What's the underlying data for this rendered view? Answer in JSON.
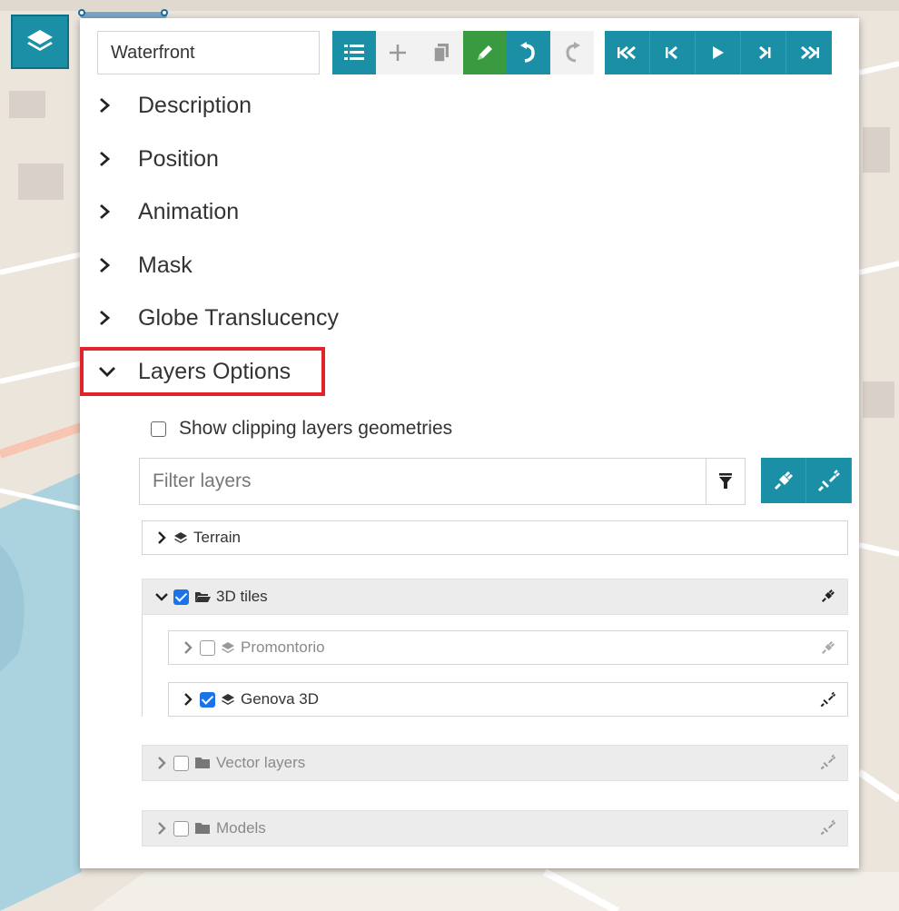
{
  "toolbar": {
    "story_name": "Waterfront"
  },
  "sections": [
    {
      "label": "Description",
      "expanded": false
    },
    {
      "label": "Position",
      "expanded": false
    },
    {
      "label": "Animation",
      "expanded": false
    },
    {
      "label": "Mask",
      "expanded": false
    },
    {
      "label": "Globe Translucency",
      "expanded": false
    },
    {
      "label": "Layers Options",
      "expanded": true
    }
  ],
  "layers_options": {
    "show_clipping_label": "Show clipping layers geometries",
    "show_clipping_checked": false,
    "filter_placeholder": "Filter layers",
    "tree": [
      {
        "label": "Terrain",
        "type": "layer",
        "checked": null,
        "expanded": false
      },
      {
        "label": "3D tiles",
        "type": "group",
        "checked": true,
        "expanded": true,
        "children": [
          {
            "label": "Promontorio",
            "checked": false
          },
          {
            "label": "Genova 3D",
            "checked": true
          }
        ]
      },
      {
        "label": "Vector layers",
        "type": "group",
        "checked": false,
        "expanded": false
      },
      {
        "label": "Models",
        "type": "group",
        "checked": false,
        "expanded": false
      }
    ]
  },
  "colors": {
    "accent": "#1b8fa6",
    "edit_active": "#3a9a3f",
    "highlight": "#e3232b",
    "checkbox": "#1a73e8"
  }
}
